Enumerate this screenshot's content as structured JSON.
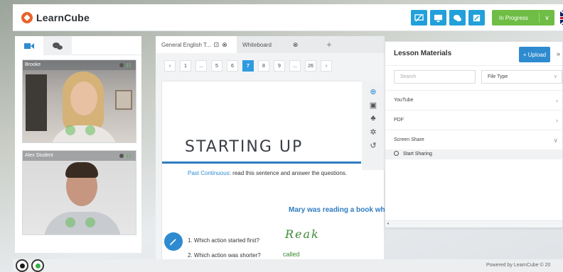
{
  "app": {
    "brand": "LearnCube",
    "accent": "#22a0da",
    "status_color": "#6fbd45"
  },
  "toolbar": {
    "tools": [
      "screen-share-off-icon",
      "monitor-icon",
      "chat-icon",
      "edit-icon"
    ],
    "status_label": "In Progress",
    "language_flag": "uk-flag-icon"
  },
  "video": {
    "tabs": [
      "video-camera-icon",
      "chat-bubbles-icon"
    ],
    "participants": [
      {
        "name": "Brooke"
      },
      {
        "name": "Alex Student"
      }
    ]
  },
  "document": {
    "tabs": [
      {
        "label": "General English T..."
      },
      {
        "label": "Whiteboard"
      }
    ],
    "add_tab": "+",
    "pager": {
      "prev": "‹",
      "next": "›",
      "pages": [
        "1",
        "...",
        "5",
        "6",
        "7",
        "8",
        "9",
        "...",
        "26"
      ],
      "current": "7"
    },
    "sheet": {
      "title": "STARTING UP",
      "subtitle_highlight": "Past Continuous:",
      "subtitle_rest": " read this sentence and answer the questions.",
      "sentence": "Mary was reading a book whe",
      "question1": "1. Which action started first?",
      "question2": "2. Which action was shorter?",
      "handwriting1": "Reak",
      "handwriting2": "called"
    }
  },
  "materials": {
    "title": "Lesson Materials",
    "upload_label": "+ Upload",
    "more": "»",
    "search_placeholder": "Search",
    "file_type_label": "File Type",
    "rows": [
      "YouTube",
      "PDF",
      "Screen Share"
    ],
    "share_option": "Start Sharing"
  },
  "footer": {
    "powered_by": "Powered by  LearnCube © 20"
  }
}
